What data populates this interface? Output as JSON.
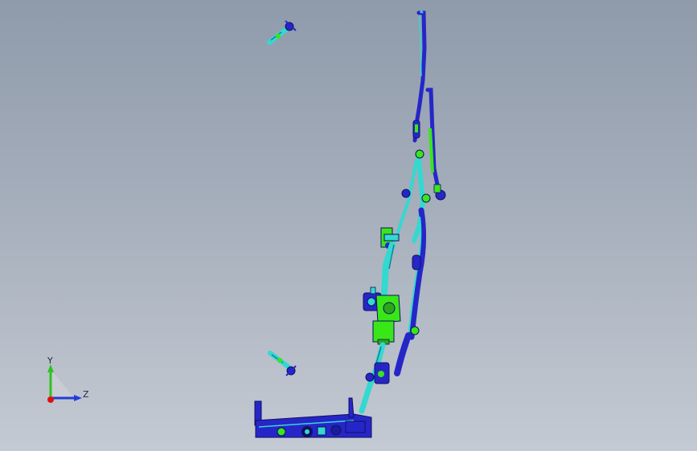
{
  "viewport": {
    "background_top": "#8f9bab",
    "background_bottom": "#c4cad3"
  },
  "model": {
    "colors": {
      "primary_part": "#2626c8",
      "secondary_part": "#33d9cf",
      "motor_part": "#39e618",
      "edge": "#101060"
    }
  },
  "triad": {
    "y_label": "Y",
    "z_label": "Z",
    "y_color": "#2ec31e",
    "z_color": "#1f3fd8",
    "x_color": "#e01010"
  }
}
